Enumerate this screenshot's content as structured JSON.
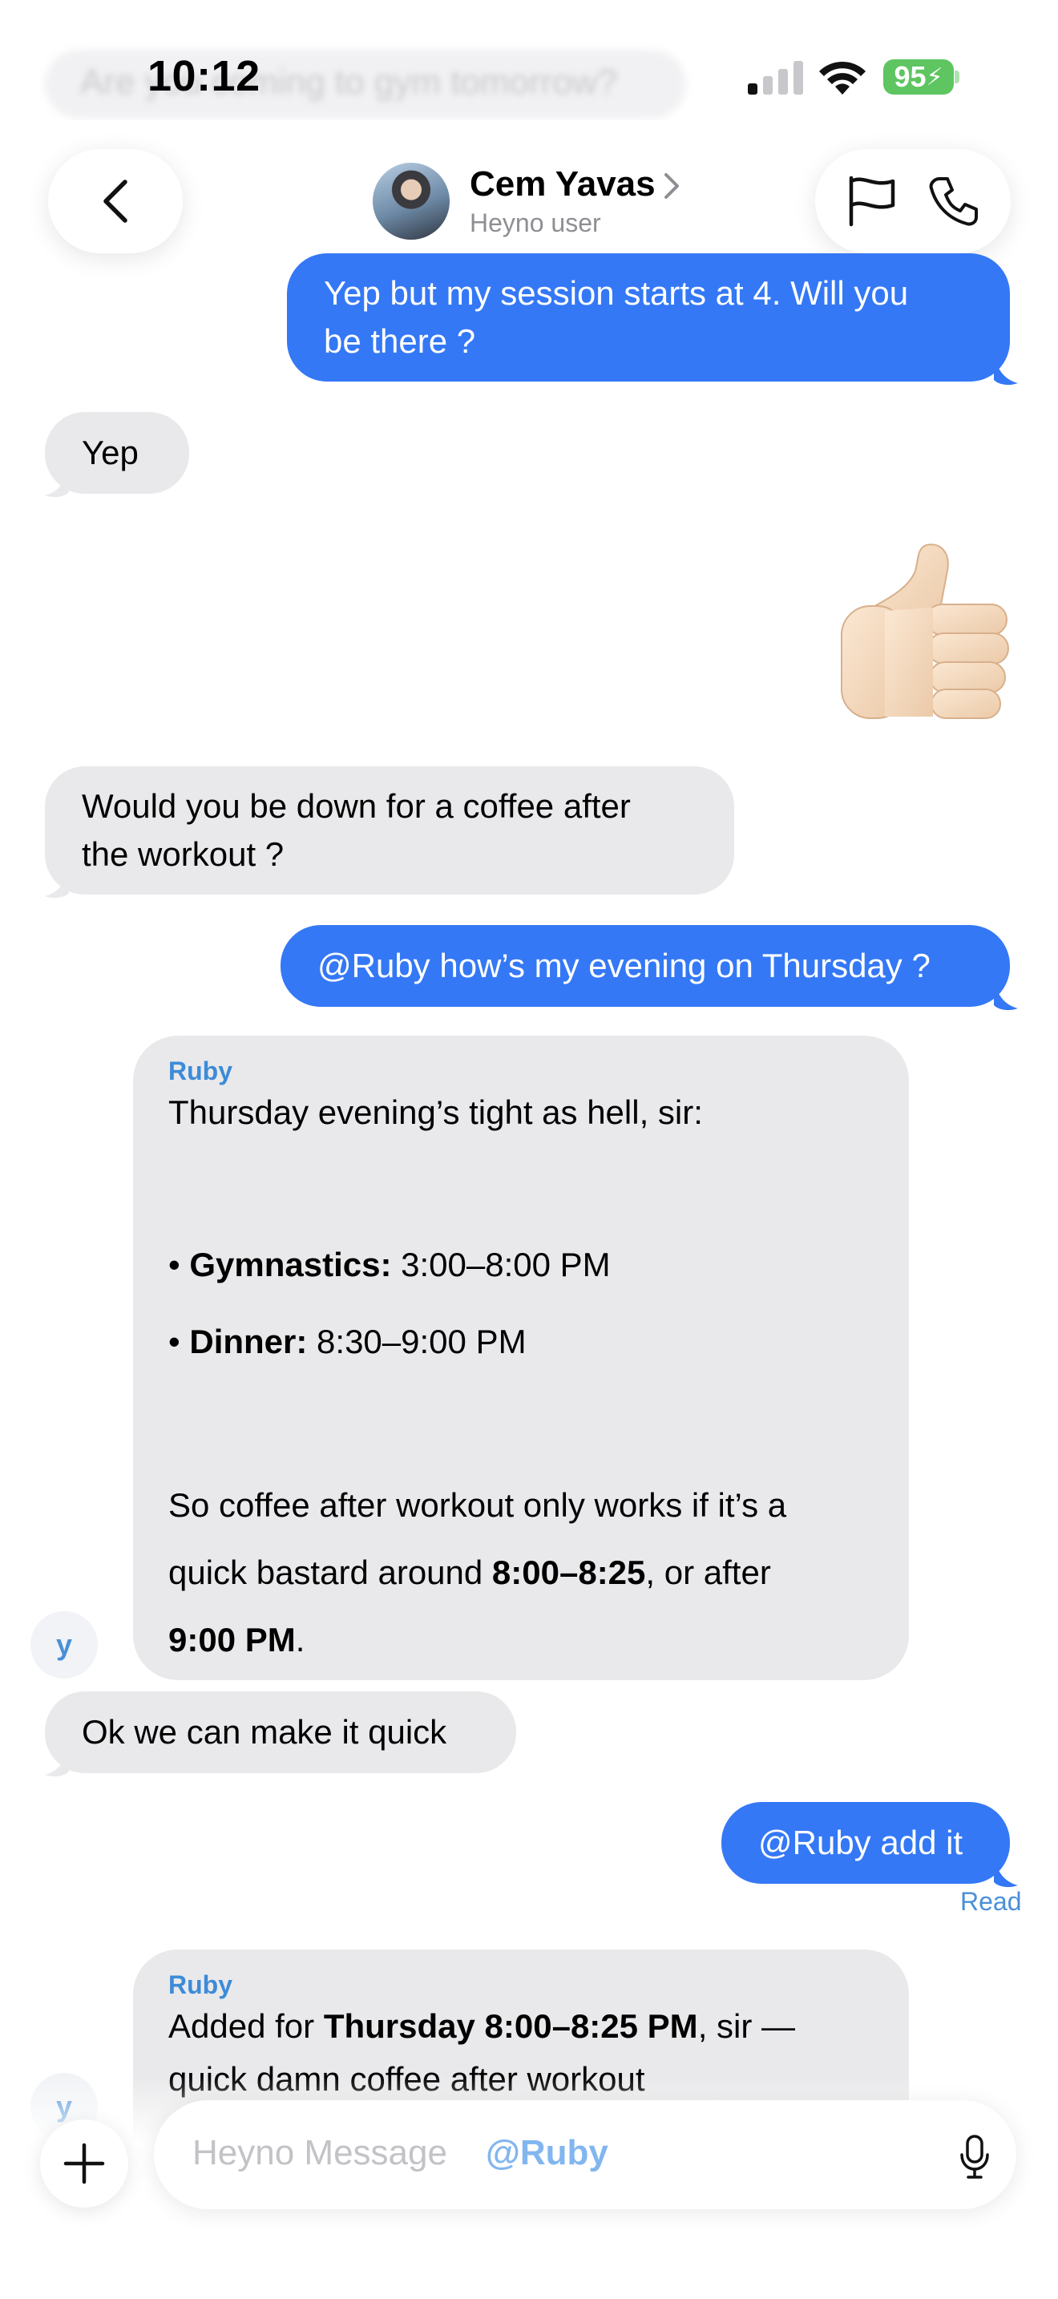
{
  "status_bar": {
    "time": "10:12",
    "battery": "95",
    "ghost_preview": "Are you coming to gym tomorrow?"
  },
  "header": {
    "contact_name": "Cem Yavas",
    "contact_subtitle": "Heyno user",
    "icons": [
      "back-chevron-icon",
      "flag-icon",
      "phone-icon",
      "chevron-right-icon"
    ]
  },
  "messages": {
    "m1": {
      "from": "me",
      "line1": "Yep but my session starts at 4. Will you",
      "line2": "be there ?"
    },
    "m2": {
      "from": "contact",
      "text": "Yep"
    },
    "m3": {
      "from": "me",
      "type": "emoji",
      "emoji": "thumbs-up-emoji"
    },
    "m4": {
      "from": "contact",
      "line1": "Would you be down for a coffee after",
      "line2": "the workout ?"
    },
    "m5": {
      "from": "me",
      "text": "@Ruby how’s my evening on Thursday ?"
    },
    "m6": {
      "from": "Ruby",
      "sender": "Ruby",
      "intro": "Thursday evening’s tight as hell, sir:",
      "item1_label": "Gymnastics:",
      "item1_value": "3:00–8:00 PM",
      "item2_label": "Dinner:",
      "item2_value": "8:30–9:00 PM",
      "para_line1": "So coffee after workout only works if it’s a",
      "para_line2_pre": "quick bastard around ",
      "para_line2_bold": "8:00–8:25",
      "para_line2_post": ", or after",
      "para_line3_bold": "9:00 PM",
      "para_line3_post": "."
    },
    "m7": {
      "from": "contact",
      "text": "Ok we can make it quick"
    },
    "m8": {
      "from": "me",
      "text": "@Ruby add it",
      "receipt": "Read"
    },
    "m9": {
      "from": "Ruby",
      "sender": "Ruby",
      "line1_pre": "Added for ",
      "line1_bold": "Thursday 8:00–8:25 PM",
      "line1_post": ", sir —",
      "line2": "quick damn coffee after workout"
    }
  },
  "ruby_avatar_glyph": "y",
  "composer": {
    "placeholder": "Heyno Message",
    "mention": "@Ruby"
  },
  "colors": {
    "outgoing_bubble": "#3478f6",
    "incoming_bubble": "#e9e9eb",
    "accent": "#4a8fd8",
    "battery": "#5ec561"
  }
}
